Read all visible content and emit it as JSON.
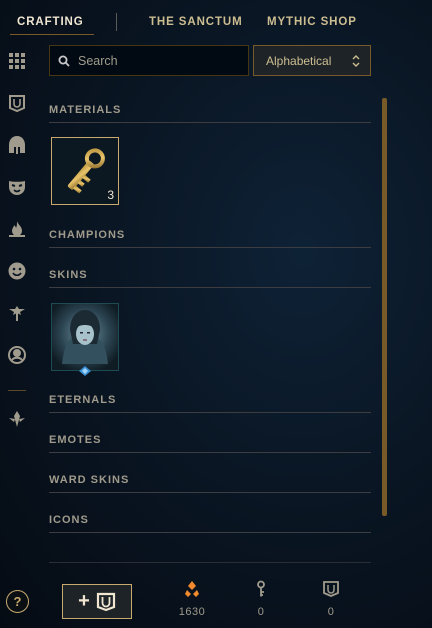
{
  "nav": {
    "tabs": [
      {
        "label": "CRAFTING"
      },
      {
        "label": "THE SANCTUM"
      },
      {
        "label": "MYTHIC SHOP"
      }
    ]
  },
  "sidebar": {
    "icons": [
      "grid-icon",
      "chest-icon",
      "helmet-icon",
      "mask-icon",
      "flame-icon",
      "emote-face-icon",
      "ward-icon",
      "profile-icon",
      "eternals-icon"
    ],
    "help_label": "?"
  },
  "search": {
    "placeholder": "Search",
    "value": ""
  },
  "sort": {
    "selected": "Alphabetical"
  },
  "sections": [
    {
      "title": "MATERIALS"
    },
    {
      "title": "CHAMPIONS"
    },
    {
      "title": "SKINS"
    },
    {
      "title": "ETERNALS"
    },
    {
      "title": "EMOTES"
    },
    {
      "title": "WARD SKINS"
    },
    {
      "title": "ICONS"
    }
  ],
  "materials": {
    "key_count": "3"
  },
  "footer": {
    "add_label": "+",
    "currencies": [
      {
        "icon": "orange-essence-icon",
        "value": "1630"
      },
      {
        "icon": "key-fragment-icon",
        "value": "0"
      },
      {
        "icon": "chest-icon",
        "value": "0"
      }
    ]
  },
  "colors": {
    "gold": "#c8aa6e",
    "orange_essence": "#f08a2c",
    "text": "#a09b8c"
  }
}
